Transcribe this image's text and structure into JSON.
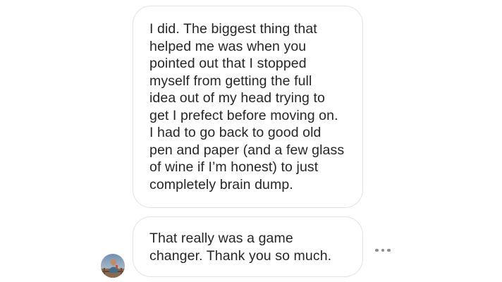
{
  "messages": [
    {
      "lines": [
        "I did. The biggest thing that",
        "helped me was when you",
        "pointed out that I stopped",
        "myself from getting the full",
        "idea out of my head trying to",
        "get I prefect before moving on.",
        "I had to go back to good old",
        "pen and paper (and a few glass",
        "of wine if I’m honest) to just",
        "completely brain dump."
      ]
    },
    {
      "lines": [
        "That really was a game",
        "changer. Thank you so much."
      ]
    }
  ],
  "avatar": {
    "icon": "profile-photo"
  },
  "more_button": {
    "icon": "more-horizontal-icon"
  },
  "colors": {
    "text": "#262626",
    "bubble_border": "#e3e3e3",
    "background": "#ffffff",
    "more_dots": "#8e8e8e"
  }
}
